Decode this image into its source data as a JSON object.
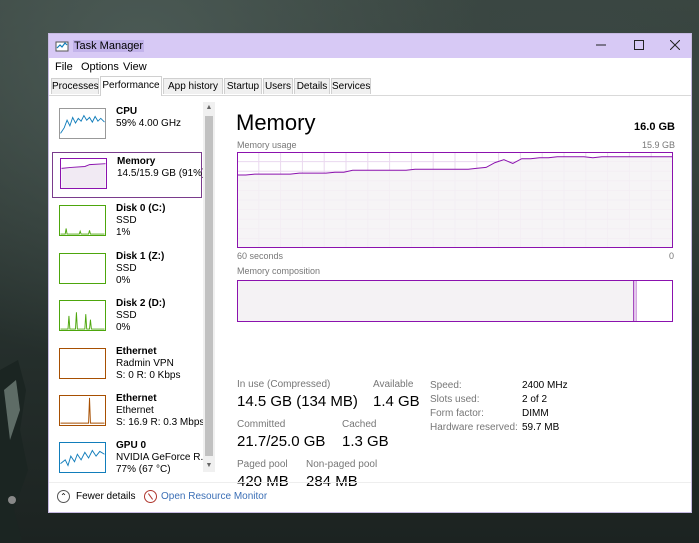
{
  "window": {
    "title": "Task Manager"
  },
  "menu": [
    "File",
    "Options",
    "View"
  ],
  "tabs": [
    "Processes",
    "Performance",
    "App history",
    "Startup",
    "Users",
    "Details",
    "Services"
  ],
  "active_tab": "Performance",
  "sidebar": [
    {
      "title": "CPU",
      "line2": "59% 4.00 GHz",
      "line3": "",
      "icon": "cpu-graph",
      "color": "#117dbb"
    },
    {
      "title": "Memory",
      "line2": "14.5/15.9 GB (91%)",
      "line3": "",
      "icon": "memory-graph",
      "color": "#8b12ae"
    },
    {
      "title": "Disk 0 (C:)",
      "line2": "SSD",
      "line3": "1%",
      "icon": "disk-graph",
      "color": "#4da60c"
    },
    {
      "title": "Disk 1 (Z:)",
      "line2": "SSD",
      "line3": "0%",
      "icon": "disk-graph",
      "color": "#4da60c"
    },
    {
      "title": "Disk 2 (D:)",
      "line2": "SSD",
      "line3": "0%",
      "icon": "disk-graph",
      "color": "#4da60c"
    },
    {
      "title": "Ethernet",
      "line2": "Radmin VPN",
      "line3": "S: 0 R: 0 Kbps",
      "icon": "network-graph",
      "color": "#a74f01"
    },
    {
      "title": "Ethernet",
      "line2": "Ethernet",
      "line3": "S: 16.9 R: 0.3 Mbps",
      "icon": "network-graph",
      "color": "#a74f01"
    },
    {
      "title": "GPU 0",
      "line2": "NVIDIA GeForce R...",
      "line3": "77% (67 °C)",
      "icon": "gpu-graph",
      "color": "#117dbb"
    }
  ],
  "main": {
    "heading": "Memory",
    "total": "16.0 GB",
    "usage_label": "Memory usage",
    "usage_max": "15.9 GB",
    "axis_left": "60 seconds",
    "axis_right": "0",
    "composition_label": "Memory composition",
    "in_use_label": "In use (Compressed)",
    "in_use_value": "14.5 GB (134 MB)",
    "available_label": "Available",
    "available_value": "1.4 GB",
    "committed_label": "Committed",
    "committed_value": "21.7/25.0 GB",
    "cached_label": "Cached",
    "cached_value": "1.3 GB",
    "paged_label": "Paged pool",
    "paged_value": "420 MB",
    "nonpaged_label": "Non-paged pool",
    "nonpaged_value": "284 MB",
    "details": [
      {
        "label": "Speed:",
        "value": "2400 MHz"
      },
      {
        "label": "Slots used:",
        "value": "2 of 2"
      },
      {
        "label": "Form factor:",
        "value": "DIMM"
      },
      {
        "label": "Hardware reserved:",
        "value": "59.7 MB"
      }
    ]
  },
  "usage_history": [
    0.76,
    0.76,
    0.77,
    0.77,
    0.77,
    0.77,
    0.77,
    0.78,
    0.78,
    0.78,
    0.78,
    0.79,
    0.79,
    0.81,
    0.81,
    0.81,
    0.81,
    0.81,
    0.81,
    0.81,
    0.82,
    0.82,
    0.82,
    0.82,
    0.82,
    0.82,
    0.82,
    0.83,
    0.84,
    0.89,
    0.92,
    0.88,
    0.93,
    0.93,
    0.94,
    0.94,
    0.95,
    0.95,
    0.95,
    0.95,
    0.94,
    0.95,
    0.95,
    0.95,
    0.95,
    0.95,
    0.95,
    0.95,
    0.95,
    0.95
  ],
  "composition": {
    "in_use_fraction": 0.91,
    "modified_fraction": 0.003
  },
  "footer": {
    "fewer_details": "Fewer details",
    "resource_monitor": "Open Resource Monitor"
  },
  "colors": {
    "memory": "#8b12ae",
    "memory_fill": "#f4f2f4",
    "grid": "#ead8ef",
    "title_bar": "#d7c9f5"
  }
}
